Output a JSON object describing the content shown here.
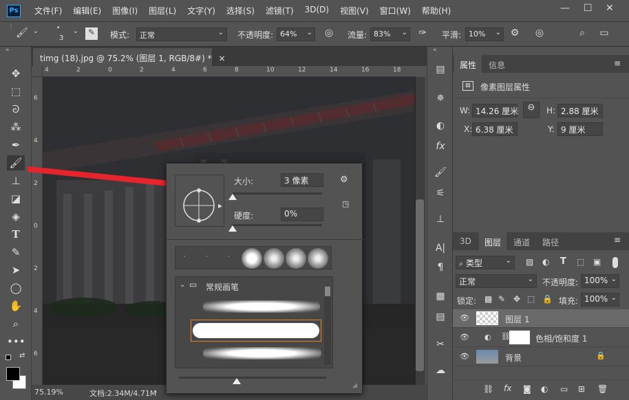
{
  "app": {
    "logo": "Ps"
  },
  "menu": [
    "文件(F)",
    "编辑(E)",
    "图像(I)",
    "图层(L)",
    "文字(Y)",
    "选择(S)",
    "滤镜(T)",
    "3D(D)",
    "视图(V)",
    "窗口(W)",
    "帮助(H)"
  ],
  "window_controls": {
    "minimize": "—",
    "maximize": "☐",
    "close": "✕"
  },
  "options": {
    "brush_size": "3",
    "mode_label": "模式:",
    "mode_value": "正常",
    "opacity_label": "不透明度:",
    "opacity_value": "64%",
    "flow_label": "流量:",
    "flow_value": "83%",
    "smooth_label": "平滑:",
    "smooth_value": "10%"
  },
  "document": {
    "tab_title": "timg (18).jpg @ 75.2% (图层 1, RGB/8#) *",
    "tab_close": "×",
    "ruler_top_ticks": [
      "4",
      "2",
      "0",
      "2",
      "4",
      "6",
      "8",
      "10",
      "12",
      "14",
      "16",
      "18"
    ],
    "ruler_left_ticks": [
      "6",
      "4",
      "2",
      "0",
      "2",
      "4",
      "6",
      "8"
    ],
    "zoom": "75.19%",
    "doc_info": "文档:2.34M/4.71M"
  },
  "brush_popup": {
    "size_label": "大小:",
    "size_value": "3 像素",
    "size_fraction": 0.0,
    "hardness_label": "硬度:",
    "hardness_value": "0%",
    "hardness_fraction": 0.0,
    "folder_label": "常规画笔"
  },
  "properties": {
    "tab_properties": "属性",
    "tab_info": "信息",
    "title": "像素图层属性",
    "w_label": "W:",
    "w_value": "14.26 厘米",
    "h_label": "H:",
    "h_value": "2.88 厘米",
    "x_label": "X:",
    "x_value": "6.38 厘米",
    "y_label": "Y:",
    "y_value": "9 厘米"
  },
  "layers_panel": {
    "tabs": [
      "3D",
      "图层",
      "通道",
      "路径"
    ],
    "filter_label": "类型",
    "blend_mode": "正常",
    "opacity_label": "不透明度:",
    "opacity_value": "100%",
    "lock_label": "锁定:",
    "fill_label": "填充:",
    "fill_value": "100%",
    "layers": [
      {
        "name": "图层 1"
      },
      {
        "name": "色相/饱和度 1"
      },
      {
        "name": "背景"
      }
    ],
    "bottom_icons": [
      "link-icon",
      "fx-icon",
      "mask-icon",
      "adjustment-icon",
      "group-icon",
      "new-layer-icon",
      "trash-icon"
    ]
  },
  "colors": {
    "arrow": "#e5252b",
    "selection_border": "#e8822a",
    "ps_blue": "#31a8ff"
  }
}
